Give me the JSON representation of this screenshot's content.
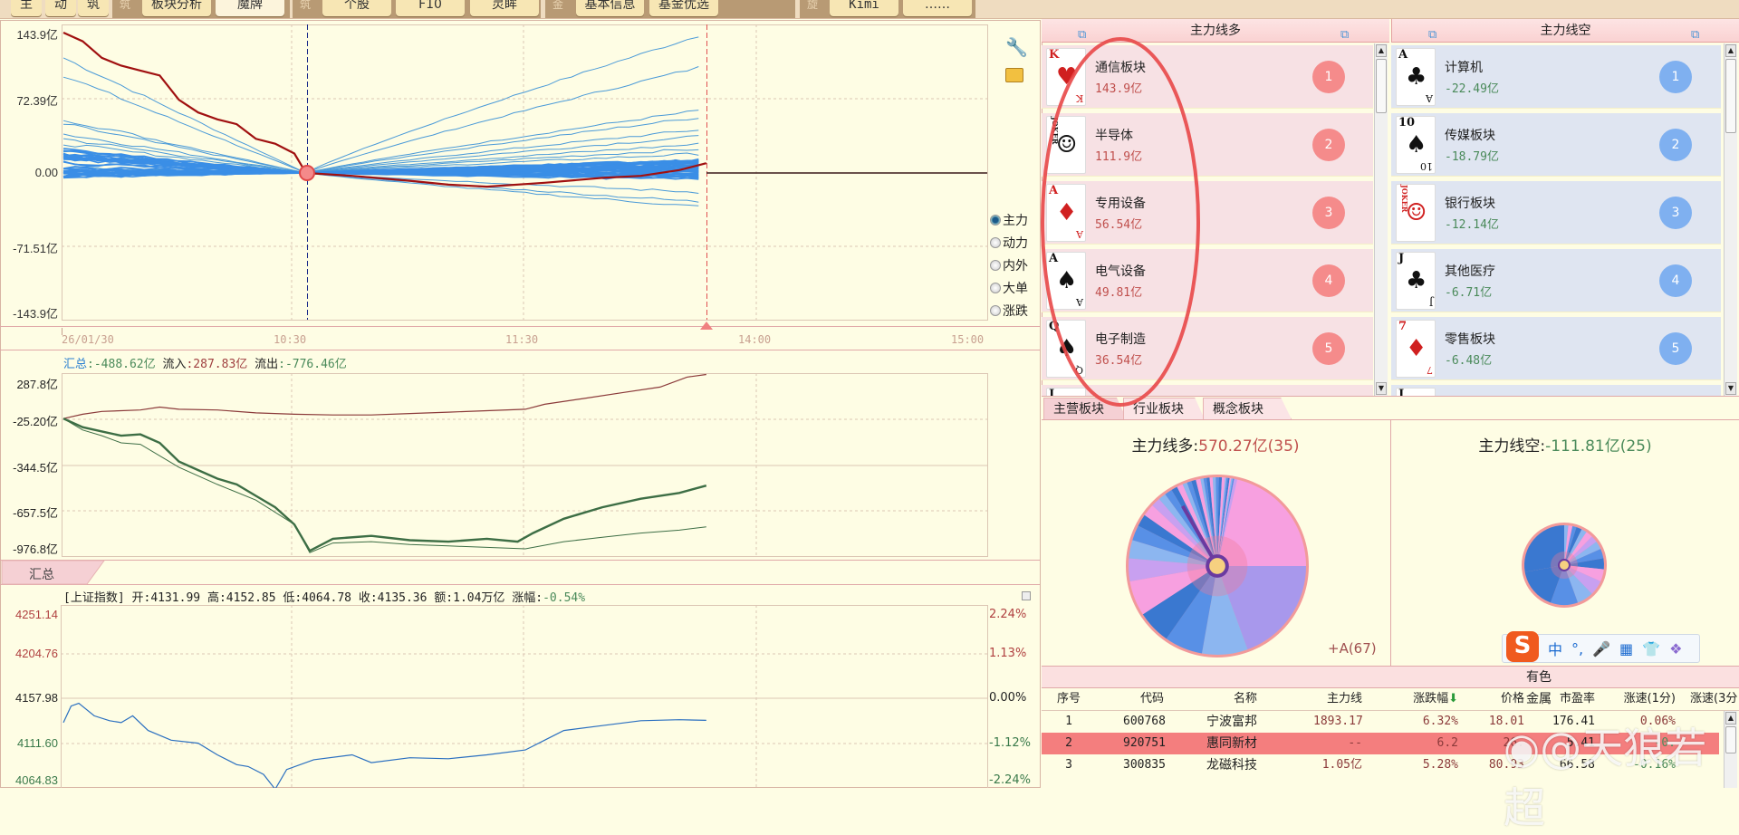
{
  "toolbar": {
    "small_buttons": [
      "主",
      "动",
      "筑"
    ],
    "groups": [
      {
        "icon": "筑",
        "buttons": [
          "板块分析",
          "魔牌"
        ]
      },
      {
        "icon": "筑",
        "buttons": [
          "个股",
          "F10",
          "灵眸"
        ]
      },
      {
        "icon": "金",
        "buttons": [
          "基本信息",
          "基金优选"
        ]
      },
      {
        "icon": "旋",
        "buttons": [
          "Kimi",
          "……"
        ]
      }
    ]
  },
  "main_chart": {
    "y_labels": [
      "143.9亿",
      "72.39亿",
      "0.00",
      "-71.51亿",
      "-143.9亿"
    ],
    "x_labels": [
      "26/01/30",
      "10:30",
      "11:30",
      "14:00",
      "15:00"
    ],
    "radio_options": [
      {
        "label": "主力",
        "selected": true
      },
      {
        "label": "动力",
        "selected": false
      },
      {
        "label": "内外",
        "selected": false
      },
      {
        "label": "大单",
        "selected": false
      },
      {
        "label": "涨跌",
        "selected": false
      }
    ],
    "icons": [
      "wrench-icon",
      "toolbox-icon"
    ]
  },
  "flow_chart": {
    "summary_label": "汇总",
    "summary_value": ":-488.62亿",
    "inflow_label": "流入",
    "inflow_value": ":287.83亿",
    "outflow_label": "流出",
    "outflow_value": ":-776.46亿",
    "y_labels": [
      "287.8亿",
      "-25.20亿",
      "-344.5亿",
      "-657.5亿",
      "-976.8亿"
    ],
    "tab_label": "汇总"
  },
  "index_chart": {
    "name": "[上证指数]",
    "open_label": "开:",
    "open": "4131.99",
    "high_label": "高:",
    "high": "4152.85",
    "low_label": "低:",
    "low": "4064.78",
    "close_label": "收:",
    "close": "4135.36",
    "amount_label": "额:",
    "amount": "1.04万亿",
    "change_label": "涨幅:",
    "change": "-0.54%",
    "y_labels_left": [
      "4251.14",
      "4204.76",
      "4157.98",
      "4111.60",
      "4064.83"
    ],
    "y_labels_right": [
      "2.24%",
      "1.13%",
      "0.00%",
      "-1.12%",
      "-2.24%"
    ]
  },
  "chart_data": [
    {
      "type": "line",
      "title": "主力线",
      "xlabel": "time",
      "ylabel": "亿",
      "ylim": [
        -143.9,
        143.9
      ],
      "x_unit": "trading minutes since 09:30",
      "series": [
        {
          "name": "主力线(汇总)",
          "points": [
            [
              0,
              143.9
            ],
            [
              5,
              135
            ],
            [
              10,
              118
            ],
            [
              15,
              110
            ],
            [
              20,
              105
            ],
            [
              25,
              100
            ],
            [
              30,
              75
            ],
            [
              35,
              62
            ],
            [
              40,
              55
            ],
            [
              45,
              50
            ],
            [
              50,
              35
            ],
            [
              55,
              30
            ],
            [
              60,
              20
            ],
            [
              63,
              0
            ],
            [
              75,
              -3
            ],
            [
              90,
              -8
            ],
            [
              100,
              -12
            ],
            [
              110,
              -14
            ],
            [
              125,
              -10
            ],
            [
              140,
              -5
            ],
            [
              150,
              -3
            ],
            [
              160,
              3
            ],
            [
              167,
              10
            ]
          ]
        }
      ]
    },
    {
      "type": "line",
      "title": "汇总/流入/流出",
      "ylim": [
        -976.8,
        287.8
      ],
      "series": [
        {
          "name": "流入",
          "points": [
            [
              0,
              -20
            ],
            [
              5,
              10
            ],
            [
              10,
              30
            ],
            [
              20,
              40
            ],
            [
              25,
              60
            ],
            [
              30,
              45
            ],
            [
              40,
              40
            ],
            [
              50,
              20
            ],
            [
              60,
              10
            ],
            [
              70,
              5
            ],
            [
              80,
              5
            ],
            [
              90,
              15
            ],
            [
              100,
              25
            ],
            [
              110,
              35
            ],
            [
              120,
              45
            ],
            [
              125,
              80
            ],
            [
              135,
              120
            ],
            [
              145,
              160
            ],
            [
              155,
              200
            ],
            [
              162,
              270
            ],
            [
              167,
              287.8
            ]
          ]
        },
        {
          "name": "汇总",
          "points": [
            [
              0,
              -20
            ],
            [
              5,
              -80
            ],
            [
              10,
              -110
            ],
            [
              15,
              -140
            ],
            [
              20,
              -130
            ],
            [
              25,
              -190
            ],
            [
              30,
              -320
            ],
            [
              35,
              -380
            ],
            [
              40,
              -440
            ],
            [
              45,
              -480
            ],
            [
              50,
              -560
            ],
            [
              55,
              -640
            ],
            [
              60,
              -760
            ],
            [
              64,
              -944
            ],
            [
              70,
              -860
            ],
            [
              80,
              -840
            ],
            [
              90,
              -870
            ],
            [
              100,
              -880
            ],
            [
              110,
              -860
            ],
            [
              118,
              -880
            ],
            [
              122,
              -820
            ],
            [
              130,
              -720
            ],
            [
              140,
              -640
            ],
            [
              150,
              -580
            ],
            [
              160,
              -540
            ],
            [
              167,
              -488.62
            ]
          ]
        },
        {
          "name": "流出",
          "points": [
            [
              0,
              -20
            ],
            [
              5,
              -100
            ],
            [
              10,
              -140
            ],
            [
              15,
              -190
            ],
            [
              20,
              -200
            ],
            [
              30,
              -360
            ],
            [
              40,
              -480
            ],
            [
              50,
              -590
            ],
            [
              60,
              -760
            ],
            [
              64,
              -957
            ],
            [
              70,
              -890
            ],
            [
              80,
              -880
            ],
            [
              90,
              -900
            ],
            [
              100,
              -910
            ],
            [
              110,
              -920
            ],
            [
              120,
              -930
            ],
            [
              130,
              -880
            ],
            [
              140,
              -850
            ],
            [
              150,
              -820
            ],
            [
              160,
              -800
            ],
            [
              167,
              -776.46
            ]
          ]
        }
      ]
    },
    {
      "type": "line",
      "title": "上证指数",
      "ylim": [
        4064.83,
        4251.14
      ],
      "series": [
        {
          "name": "上证指数",
          "points": [
            [
              0,
              4133
            ],
            [
              2,
              4150
            ],
            [
              4,
              4152.85
            ],
            [
              8,
              4140
            ],
            [
              12,
              4135
            ],
            [
              15,
              4133
            ],
            [
              18,
              4140
            ],
            [
              22,
              4125
            ],
            [
              28,
              4115
            ],
            [
              35,
              4112
            ],
            [
              40,
              4100
            ],
            [
              45,
              4090
            ],
            [
              48,
              4088
            ],
            [
              52,
              4080
            ],
            [
              55,
              4064.78
            ],
            [
              58,
              4085
            ],
            [
              65,
              4095
            ],
            [
              75,
              4100
            ],
            [
              80,
              4092
            ],
            [
              90,
              4097
            ],
            [
              100,
              4096
            ],
            [
              110,
              4100
            ],
            [
              120,
              4105
            ],
            [
              125,
              4115
            ],
            [
              130,
              4125
            ],
            [
              140,
              4130
            ],
            [
              150,
              4135
            ],
            [
              160,
              4136
            ],
            [
              167,
              4135.36
            ]
          ]
        }
      ]
    }
  ],
  "long_panel": {
    "title": "主力线多",
    "items": [
      {
        "name": "通信板块",
        "value": "143.9亿",
        "rank": "1",
        "card": "K",
        "suit": "♥",
        "red": true
      },
      {
        "name": "半导体",
        "value": "111.9亿",
        "rank": "2",
        "card": "JOKER",
        "suit": "☺",
        "red": false
      },
      {
        "name": "专用设备",
        "value": "56.54亿",
        "rank": "3",
        "card": "A",
        "suit": "♦",
        "red": true
      },
      {
        "name": "电气设备",
        "value": "49.81亿",
        "rank": "4",
        "card": "A",
        "suit": "♠",
        "red": false
      },
      {
        "name": "电子制造",
        "value": "36.54亿",
        "rank": "5",
        "card": "Q",
        "suit": "♠",
        "red": false
      }
    ]
  },
  "short_panel": {
    "title": "主力线空",
    "items": [
      {
        "name": "计算机",
        "value": "-22.49亿",
        "rank": "1",
        "card": "A",
        "suit": "♣",
        "red": false
      },
      {
        "name": "传媒板块",
        "value": "-18.79亿",
        "rank": "2",
        "card": "10",
        "suit": "♠",
        "red": false
      },
      {
        "name": "银行板块",
        "value": "-12.14亿",
        "rank": "3",
        "card": "JOKER",
        "suit": "☺",
        "red": true
      },
      {
        "name": "其他医疗",
        "value": "-6.71亿",
        "rank": "4",
        "card": "J",
        "suit": "♣",
        "red": false
      },
      {
        "name": "零售板块",
        "value": "-6.48亿",
        "rank": "5",
        "card": "7",
        "suit": "♦",
        "red": true
      }
    ]
  },
  "sector_tabs": [
    "主营板块",
    "行业板块",
    "概念板块"
  ],
  "pie_long": {
    "label": "主力线多:",
    "value": "570.27亿(35)",
    "footer": "+A(67)"
  },
  "pie_short": {
    "label": "主力线空:",
    "value": "-111.81亿(25)"
  },
  "colors": {
    "long": "#c0504d",
    "short": "#4a8a5a",
    "badge_long": "#f58b8b",
    "badge_short": "#7fb0f0",
    "accent_blue": "#3a8ee6"
  },
  "ime": {
    "logo": "S",
    "mode": "中",
    "punct": "°,"
  },
  "table": {
    "title": "有色金属",
    "headers": [
      "序号",
      "代码",
      "名称",
      "主力线",
      "涨跌幅",
      "价格",
      "市盈率",
      "涨速(1分)",
      "涨速(3分"
    ],
    "rows": [
      [
        "1",
        "600768",
        "宁波富邦",
        "1893.17万",
        "6.32%",
        "18.01",
        "176.41",
        "0.06%"
      ],
      [
        "2",
        "920751",
        "惠同新材",
        "--",
        "6.2",
        "26.",
        "5.41",
        "-0."
      ],
      [
        "3",
        "300835",
        "龙磁科技",
        "1.05亿",
        "5.28%",
        "80.93",
        "66.58",
        "-0.16%"
      ]
    ]
  },
  "watermark": "@天狼若超"
}
